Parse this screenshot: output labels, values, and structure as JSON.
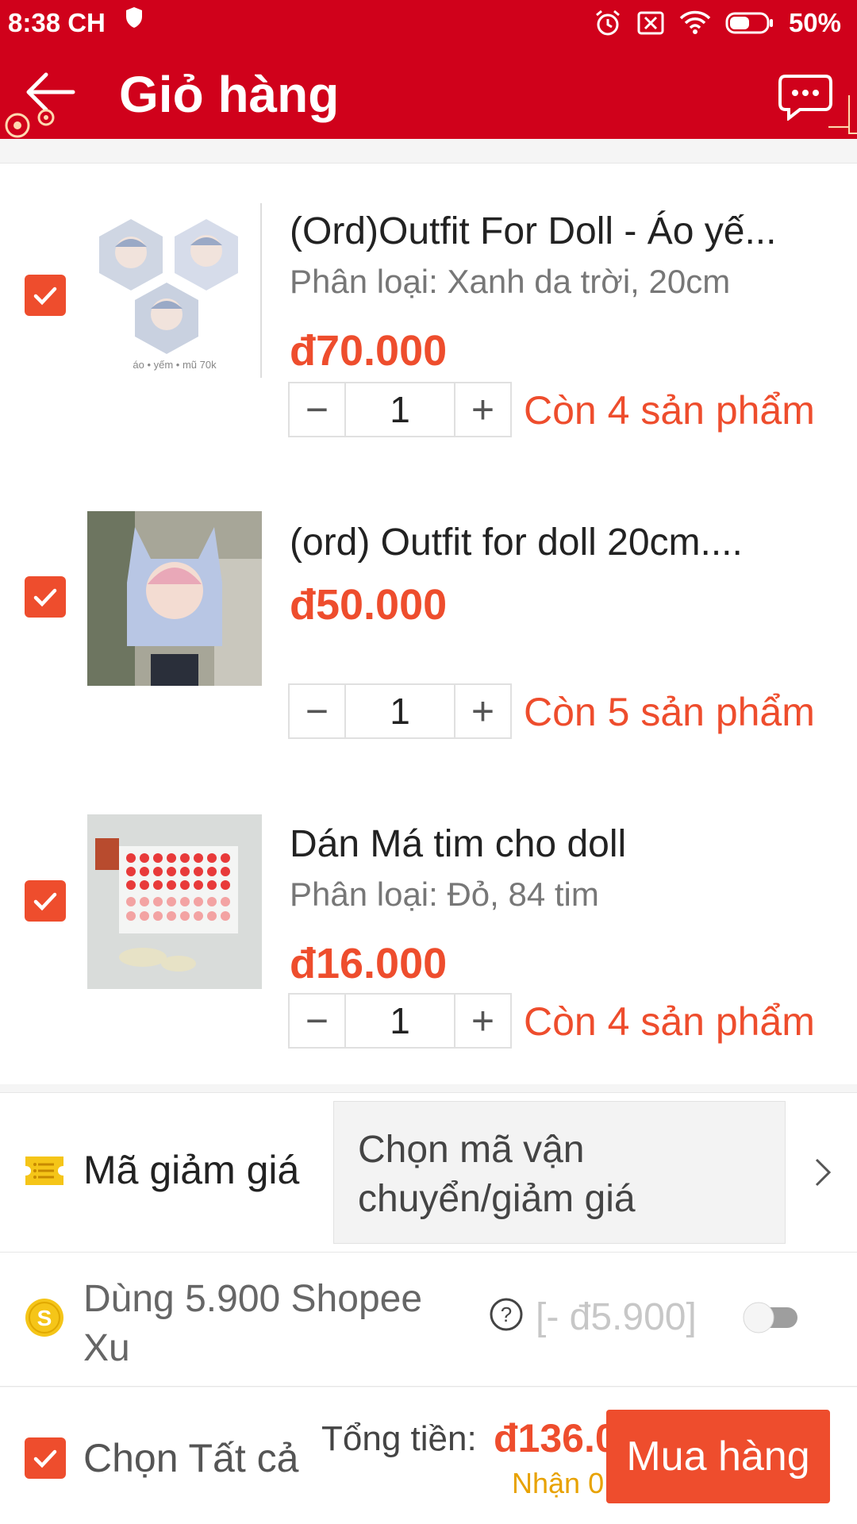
{
  "status_bar": {
    "time": "8:38 CH",
    "battery": "50%"
  },
  "header": {
    "title": "Giỏ hàng"
  },
  "items": [
    {
      "name": "(Ord)Outfit For Doll - Áo yế...",
      "variant": "Phân loại: Xanh da trời, 20cm",
      "price": "đ70.000",
      "quantity": "1",
      "stock": "Còn 4 sản phẩm",
      "thumb_caption": "áo • yếm • mũ 70k"
    },
    {
      "name": "(ord) Outfit for doll 20cm....",
      "variant": "",
      "price": "đ50.000",
      "quantity": "1",
      "stock": "Còn 5 sản phẩm"
    },
    {
      "name": "Dán Má tim cho doll",
      "variant": "Phân loại: Đỏ, 84 tim",
      "price": "đ16.000",
      "quantity": "1",
      "stock": "Còn 4 sản phẩm"
    }
  ],
  "stepper": {
    "minus": "−",
    "plus": "+"
  },
  "voucher": {
    "label": "Mã giảm giá",
    "placeholder": "Chọn mã vận chuyển/giảm giá"
  },
  "coins": {
    "label": "Dùng 5.900 Shopee Xu",
    "discount": "[- đ5.900]",
    "enabled": false
  },
  "bottom": {
    "select_all": "Chọn Tất cả",
    "total_label": "Tổng tiền:",
    "total_value": "đ136.0",
    "earn_text": "Nhận 0",
    "buy_label": "Mua hàng"
  },
  "colors": {
    "header_bg": "#d0011b",
    "accent": "#ee4d2d",
    "coin_yellow": "#f5c518"
  }
}
